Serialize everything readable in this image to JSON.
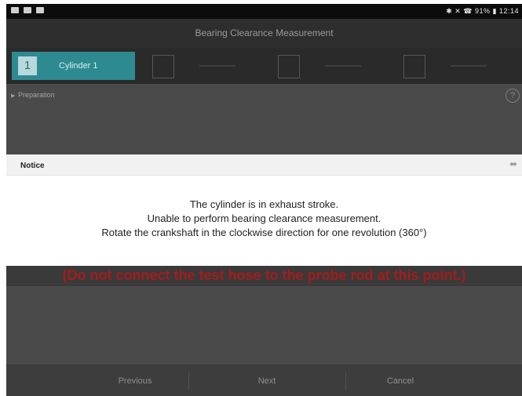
{
  "statusbar": {
    "right_text": "✱ ✕ ☎ 91% ▮ 12:14"
  },
  "window": {
    "title": "Bearing Clearance Measurement"
  },
  "steps": [
    {
      "number": "1",
      "label": "Cylinder 1"
    }
  ],
  "section": {
    "title": "Preparation",
    "help": "?"
  },
  "dialog": {
    "title": "Notice",
    "lines": [
      "The cylinder is in exhaust stroke.",
      "Unable to perform bearing clearance measurement.",
      "Rotate the crankshaft in the clockwise direction for one revolution (360°)"
    ]
  },
  "warning": "(Do not connect the test hose to the probe rod at this point.)",
  "footer": {
    "previous": "Previous",
    "next": "Next",
    "cancel": "Cancel"
  },
  "colors": {
    "accent": "#2d8a91",
    "warning": "#a51c1c"
  }
}
